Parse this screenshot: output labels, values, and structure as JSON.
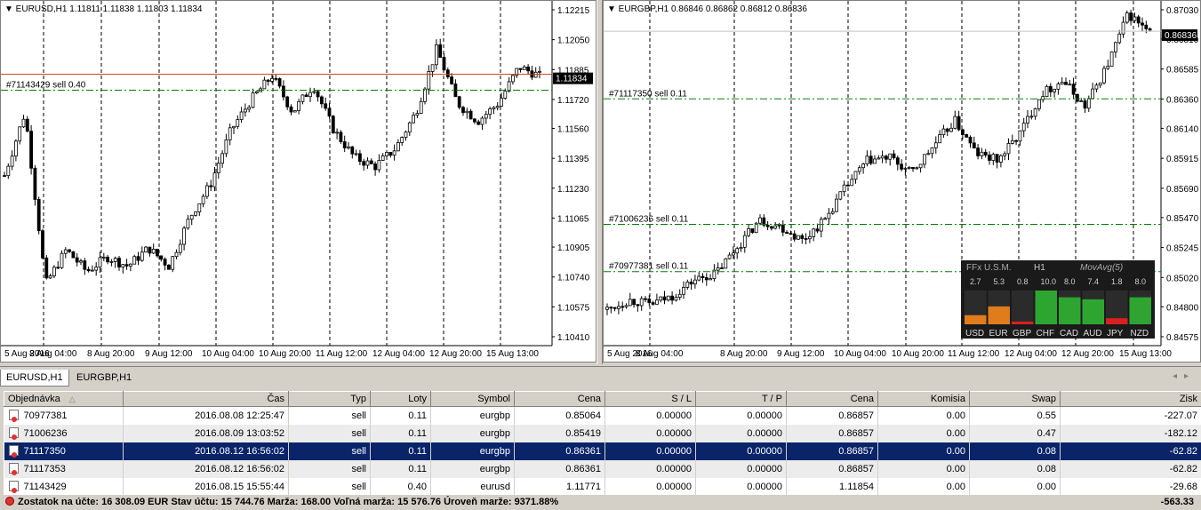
{
  "charts": [
    {
      "title": "EURUSD,H1",
      "ohlc": "1.11811 1.11838 1.11803 1.11834",
      "price_labels": [
        "1.12215",
        "1.12050",
        "1.11885",
        "1.11720",
        "1.11560",
        "1.11395",
        "1.11230",
        "1.11065",
        "1.10905",
        "1.10740",
        "1.10575",
        "1.10410"
      ],
      "time_labels": [
        "5 Aug 2016",
        "8 Aug 04:00",
        "8 Aug 20:00",
        "9 Aug 12:00",
        "10 Aug 04:00",
        "10 Aug 20:00",
        "11 Aug 12:00",
        "12 Aug 04:00",
        "12 Aug 20:00",
        "15 Aug 13:00"
      ],
      "current_price": "1.11834",
      "orders": [
        {
          "label": "#71143429 sell 0.40",
          "price": 1.11771
        }
      ],
      "bid_line_color": "#c0c0c0",
      "order_line_color": "#008000",
      "price_line_color": "#c04000"
    },
    {
      "title": "EURGBP,H1",
      "ohlc": "0.86846 0.86862 0.86812 0.86836",
      "price_labels": [
        "0.87030",
        "0.86810",
        "0.86585",
        "0.86360",
        "0.86140",
        "0.85915",
        "0.85690",
        "0.85470",
        "0.85245",
        "0.85020",
        "0.84800",
        "0.84575"
      ],
      "time_labels": [
        "5 Aug 2016",
        "8 Aug 04:00",
        "8 Aug 20:00",
        "9 Aug 12:00",
        "10 Aug 04:00",
        "10 Aug 20:00",
        "11 Aug 12:00",
        "12 Aug 04:00",
        "12 Aug 20:00",
        "15 Aug 13:00"
      ],
      "current_price": "0.86836",
      "orders": [
        {
          "label": "#71117350 sell 0.11",
          "price": 0.86361
        },
        {
          "label": "#71006236 sell 0.11",
          "price": 0.85419
        },
        {
          "label": "#70977381 sell 0.11",
          "price": 0.85064
        }
      ],
      "indicator": {
        "title": "FFx U.S.M.",
        "timeframe": "H1",
        "method": "MovAvg(5)",
        "values": [
          "2.7",
          "5.3",
          "0.8",
          "10.0",
          "8.0",
          "7.4",
          "1.8",
          "8.0"
        ],
        "currencies": [
          "USD",
          "EUR",
          "GBP",
          "CHF",
          "CAD",
          "AUD",
          "JPY",
          "NZD"
        ]
      }
    }
  ],
  "tabs": [
    "EURUSD,H1",
    "EURGBP,H1"
  ],
  "table": {
    "columns": [
      "Objednávka",
      "Čas",
      "Typ",
      "Loty",
      "Symbol",
      "Cena",
      "S / L",
      "T / P",
      "Cena",
      "Komisia",
      "Swap",
      "Zisk"
    ],
    "rows": [
      [
        "70977381",
        "2016.08.08 12:25:47",
        "sell",
        "0.11",
        "eurgbp",
        "0.85064",
        "0.00000",
        "0.00000",
        "0.86857",
        "0.00",
        "0.55",
        "-227.07"
      ],
      [
        "71006236",
        "2016.08.09 13:03:52",
        "sell",
        "0.11",
        "eurgbp",
        "0.85419",
        "0.00000",
        "0.00000",
        "0.86857",
        "0.00",
        "0.47",
        "-182.12"
      ],
      [
        "71117350",
        "2016.08.12 16:56:02",
        "sell",
        "0.11",
        "eurgbp",
        "0.86361",
        "0.00000",
        "0.00000",
        "0.86857",
        "0.00",
        "0.08",
        "-62.82"
      ],
      [
        "71117353",
        "2016.08.12 16:56:02",
        "sell",
        "0.11",
        "eurgbp",
        "0.86361",
        "0.00000",
        "0.00000",
        "0.86857",
        "0.00",
        "0.08",
        "-62.82"
      ],
      [
        "71143429",
        "2016.08.15 15:55:44",
        "sell",
        "0.40",
        "eurusd",
        "1.11771",
        "0.00000",
        "0.00000",
        "1.11854",
        "0.00",
        "0.00",
        "-29.68"
      ]
    ],
    "selected_row": 2
  },
  "summary": {
    "text": "Zostatok na účte: 16 308.09 EUR  Stav účtu: 15 744.76  Marža: 168.00  Voľná marža: 15 576.76  Úroveň marže: 9371.88%",
    "total": "-563.33"
  }
}
